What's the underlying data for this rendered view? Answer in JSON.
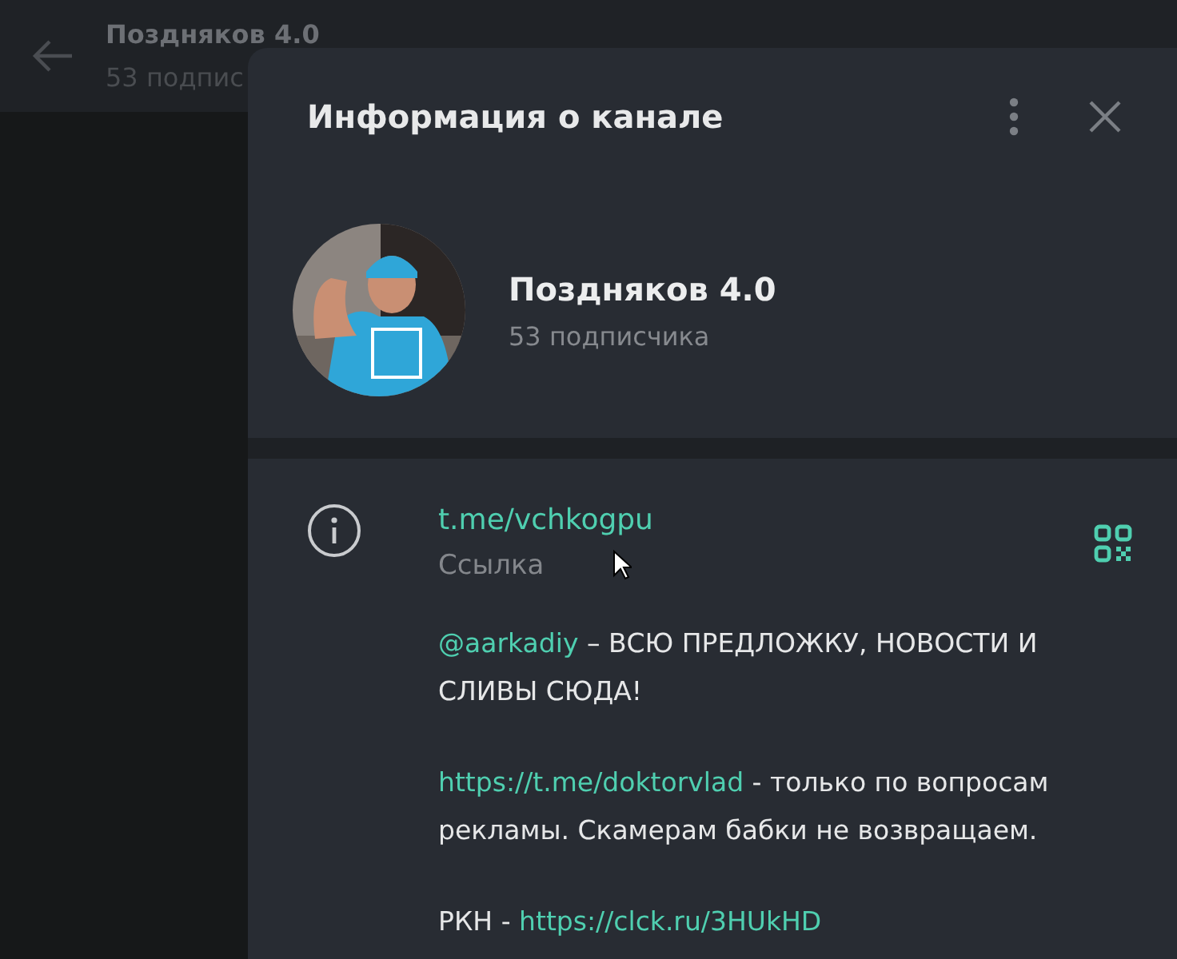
{
  "background_chat": {
    "title": "Поздняков 4.0",
    "subtitle": "53 подпис"
  },
  "dialog": {
    "title": "Информация о канале",
    "channel": {
      "name": "Поздняков 4.0",
      "subscribers": "53 подписчика"
    },
    "link": {
      "value": "t.me/vchkogpu",
      "label": "Ссылка"
    },
    "description": [
      [
        {
          "kind": "link",
          "text": "@aarkadiy"
        },
        {
          "kind": "text",
          "text": " – ВСЮ ПРЕДЛОЖКУ, НОВОСТИ И СЛИВЫ СЮДА!"
        }
      ],
      [
        {
          "kind": "link",
          "text": "https://t.me/doktorvlad"
        },
        {
          "kind": "text",
          "text": " - только по вопросам рекламы. Скамерам бабки не возвращаем."
        }
      ],
      [
        {
          "kind": "text",
          "text": "РКН - "
        },
        {
          "kind": "link",
          "text": "https://clck.ru/3HUkHD"
        }
      ]
    ]
  }
}
